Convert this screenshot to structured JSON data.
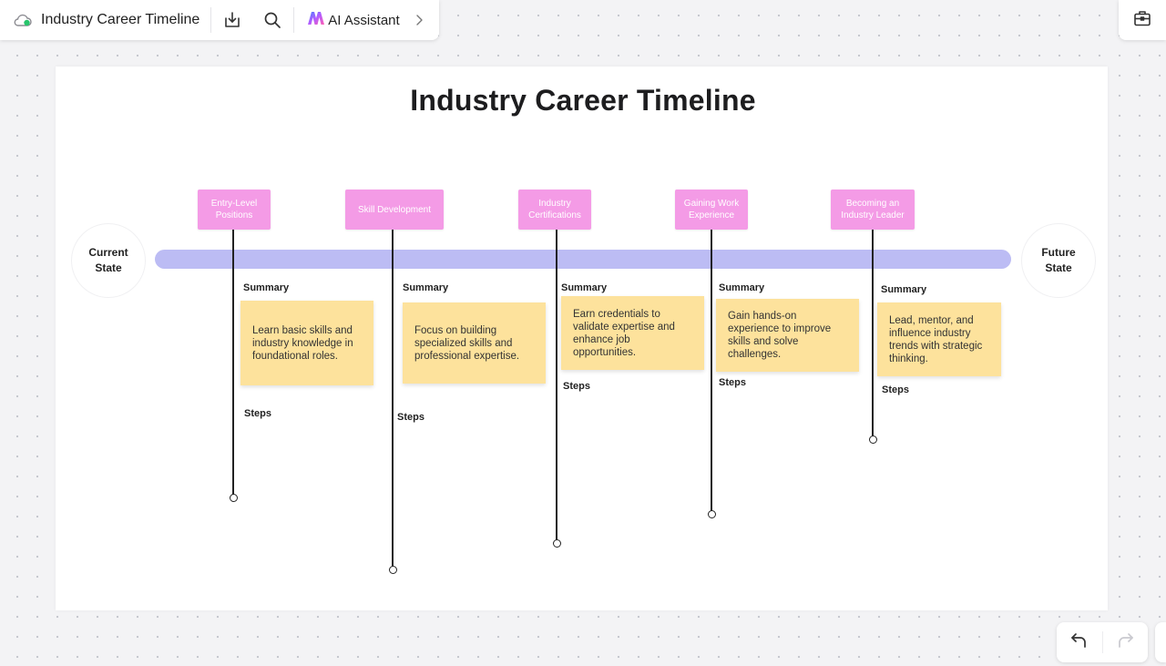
{
  "toolbar": {
    "title": "Industry Career Timeline",
    "cloud_icon": "cloud-sync-icon",
    "download_icon": "download-icon",
    "search_icon": "search-icon",
    "ai_label": "AI Assistant",
    "ai_icon": "ai-assistant-logo-icon",
    "expand_icon": "chevron-right-icon",
    "right_tool_icon": "toolbox-icon"
  },
  "diagram": {
    "title": "Industry Career Timeline",
    "start_label": "Current State",
    "end_label": "Future State",
    "timeline_color": "#bcbcf4",
    "milestone_color": "#f49be6",
    "note_color": "#fde29c",
    "milestones": [
      {
        "title": "Entry-Level Positions",
        "summary_label": "Summary",
        "summary": "Learn basic skills and industry knowledge in foundational roles.",
        "steps_label": "Steps"
      },
      {
        "title": "Skill Development",
        "summary_label": "Summary",
        "summary": "Focus on building specialized skills and professional expertise.",
        "steps_label": "Steps"
      },
      {
        "title": "Industry Certifications",
        "summary_label": "Summary",
        "summary": "Earn credentials to validate expertise and enhance job opportunities.",
        "steps_label": "Steps"
      },
      {
        "title": "Gaining Work Experience",
        "summary_label": "Summary",
        "summary": "Gain hands-on experience to improve skills and solve challenges.",
        "steps_label": "Steps"
      },
      {
        "title": "Becoming an Industry Leader",
        "summary_label": "Summary",
        "summary": "Lead, mentor, and influence industry trends with strategic thinking.",
        "steps_label": "Steps"
      }
    ]
  },
  "bottom_tools": {
    "undo_icon": "undo-icon",
    "redo_icon": "redo-icon"
  }
}
